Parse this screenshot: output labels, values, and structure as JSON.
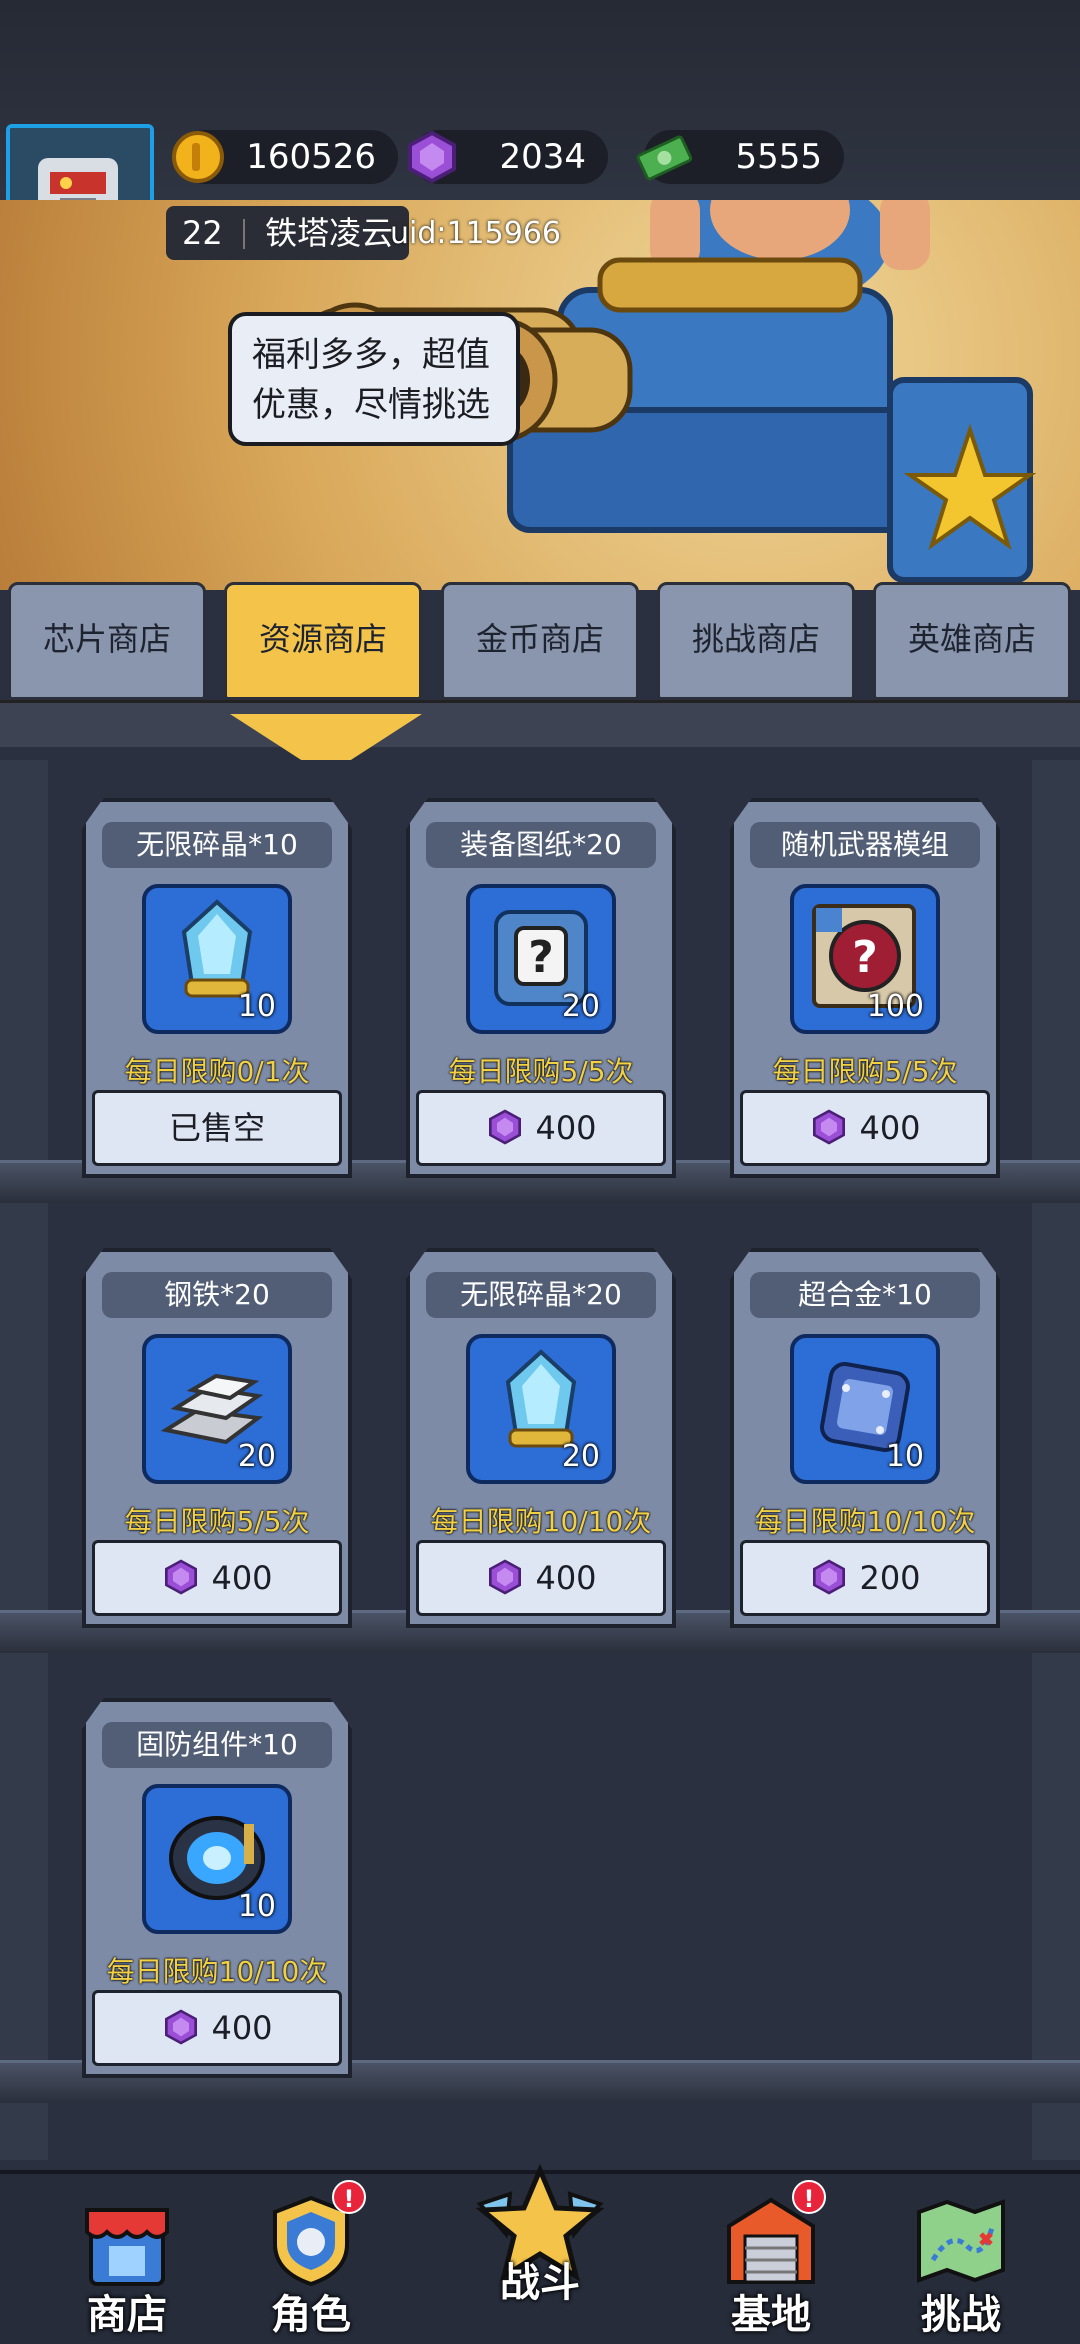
{
  "resources": {
    "coins": "160526",
    "gems": "2034",
    "cash": "5555"
  },
  "player": {
    "level": "22",
    "name": "铁塔凌云",
    "uid": "uid:115966"
  },
  "bubble": {
    "line1": "福利多多，超值",
    "line2": "优惠，尽情挑选"
  },
  "tabs": [
    {
      "label": "芯片商店"
    },
    {
      "label": "资源商店"
    },
    {
      "label": "金币商店"
    },
    {
      "label": "挑战商店"
    },
    {
      "label": "英雄商店"
    }
  ],
  "active_tab": "资源商店",
  "items": [
    {
      "title": "无限碎晶*10",
      "qty": "10",
      "limit": "每日限购0/1次",
      "price": "已售空",
      "icon": "crystal-icon"
    },
    {
      "title": "装备图纸*20",
      "qty": "20",
      "limit": "每日限购5/5次",
      "price": "400",
      "icon": "blueprint-icon"
    },
    {
      "title": "随机武器模组",
      "qty": "100",
      "limit": "每日限购5/5次",
      "price": "400",
      "icon": "weapon-module-icon"
    },
    {
      "title": "钢铁*20",
      "qty": "20",
      "limit": "每日限购5/5次",
      "price": "400",
      "icon": "steel-ingot-icon"
    },
    {
      "title": "无限碎晶*20",
      "qty": "20",
      "limit": "每日限购10/10次",
      "price": "400",
      "icon": "crystal-icon"
    },
    {
      "title": "超合金*10",
      "qty": "10",
      "limit": "每日限购10/10次",
      "price": "200",
      "icon": "alloy-icon"
    },
    {
      "title": "固防组件*10",
      "qty": "10",
      "limit": "每日限购10/10次",
      "price": "400",
      "icon": "defense-part-icon"
    }
  ],
  "nav": [
    {
      "label": "商店",
      "badge": false
    },
    {
      "label": "角色",
      "badge": true
    },
    {
      "label": "战斗",
      "badge": false
    },
    {
      "label": "基地",
      "badge": true
    },
    {
      "label": "挑战",
      "badge": false
    }
  ],
  "badge_text": "!",
  "colors": {
    "accent": "#f3c449",
    "limit_text": "#f2d044",
    "gem": "#9b4fd6",
    "panel": "#7d8ba6"
  }
}
